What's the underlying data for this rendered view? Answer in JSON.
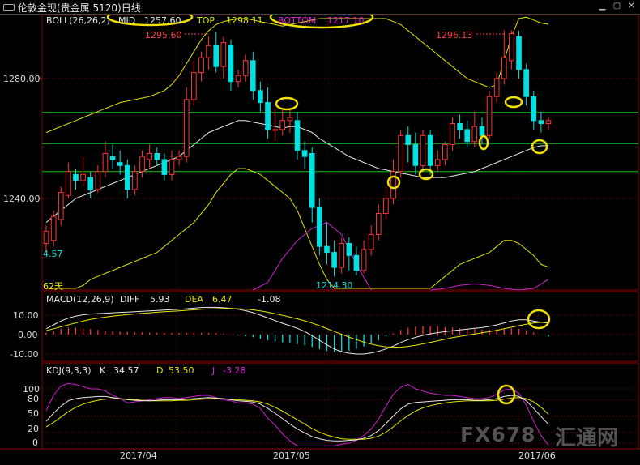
{
  "window": {
    "title": "伦敦金现(贵金属 5120)日线"
  },
  "boll": {
    "name": "BOLL(26,26,2)",
    "mid_label": "MID",
    "mid_value": "1257.60",
    "top_label": "TOP",
    "top_value": "1298.11",
    "bottom_label": "BOTTOM",
    "bottom_value": "1217.10"
  },
  "macd": {
    "name": "MACD(12,26,9)",
    "diff_label": "DIFF",
    "diff_value": "5.93",
    "dea_label": "DEA",
    "dea_value": "6.47",
    "macd_value": "-1.08"
  },
  "kdj": {
    "name": "KDJ(9,3,3)",
    "k_label": "K",
    "k_value": "34.57",
    "d_label": "D",
    "d_value": "53.50",
    "j_label": "J",
    "j_value": "-3.28"
  },
  "annotations": {
    "high1": "1295.60",
    "high2": "1296.13",
    "low": "1214.30",
    "left_low": "4.57",
    "days": "62天"
  },
  "y_ticks_main": [
    "1280.00",
    "1240.00"
  ],
  "y_ticks_macd": [
    "10.00",
    "0.00",
    "-10.00"
  ],
  "y_ticks_kdj": [
    "100",
    "80",
    "50",
    "20",
    "0"
  ],
  "x_ticks": [
    "2017/04",
    "2017/05",
    "2017/06"
  ],
  "watermark": {
    "text": "FX678",
    "cn": "汇通网"
  },
  "colors": {
    "up": "#ff3333",
    "down": "#00e0e0",
    "mid": "#e8e8e8",
    "bands": "#e0e000",
    "ma": "#d020d0",
    "level": "#00cc00",
    "circle": "#f0e000"
  },
  "chart_data": {
    "type": "candlestick",
    "y_range": [
      1206,
      1303
    ],
    "level_lines": [
      1268.7,
      1258.3,
      1249.0
    ],
    "candles": [
      [
        1225,
        1229,
        1222,
        1231
      ],
      [
        1226,
        1234,
        1224,
        1236
      ],
      [
        1233,
        1242,
        1231,
        1244
      ],
      [
        1241,
        1249,
        1240,
        1252
      ],
      [
        1248,
        1246,
        1243,
        1250
      ],
      [
        1246,
        1248,
        1244,
        1254
      ],
      [
        1247,
        1243,
        1240,
        1249
      ],
      [
        1243,
        1249,
        1242,
        1251
      ],
      [
        1249,
        1255,
        1247,
        1259
      ],
      [
        1254,
        1253,
        1250,
        1258
      ],
      [
        1252,
        1251,
        1248,
        1256
      ],
      [
        1251,
        1243,
        1240,
        1253
      ],
      [
        1243,
        1249,
        1241,
        1251
      ],
      [
        1249,
        1254,
        1247,
        1256
      ],
      [
        1253,
        1255,
        1250,
        1258
      ],
      [
        1255,
        1253,
        1251,
        1257
      ],
      [
        1253,
        1248,
        1246,
        1255
      ],
      [
        1248,
        1253,
        1246,
        1256
      ],
      [
        1253,
        1254,
        1251,
        1256
      ],
      [
        1254,
        1273,
        1252,
        1277
      ],
      [
        1273,
        1282,
        1271,
        1286
      ],
      [
        1282,
        1287,
        1279,
        1289
      ],
      [
        1287,
        1291,
        1283,
        1294
      ],
      [
        1291,
        1284,
        1282,
        1295.6
      ],
      [
        1284,
        1292,
        1280,
        1294
      ],
      [
        1291,
        1279,
        1276,
        1293
      ],
      [
        1279,
        1281,
        1277,
        1283
      ],
      [
        1281,
        1286,
        1279,
        1288
      ],
      [
        1286,
        1276,
        1273,
        1289
      ],
      [
        1276,
        1272,
        1269,
        1279
      ],
      [
        1272,
        1263,
        1260,
        1277
      ],
      [
        1263,
        1263,
        1259,
        1270
      ],
      [
        1263,
        1266,
        1261,
        1270
      ],
      [
        1266,
        1267,
        1262,
        1270
      ],
      [
        1266,
        1256,
        1253,
        1269
      ],
      [
        1256,
        1254,
        1250,
        1259
      ],
      [
        1255,
        1237,
        1232,
        1257
      ],
      [
        1237,
        1224,
        1221,
        1240
      ],
      [
        1224,
        1222,
        1218,
        1232
      ],
      [
        1222,
        1217,
        1214,
        1226
      ],
      [
        1217,
        1225,
        1215,
        1227
      ],
      [
        1225,
        1221,
        1216,
        1227
      ],
      [
        1221,
        1216,
        1214.3,
        1224
      ],
      [
        1216,
        1223,
        1215,
        1226
      ],
      [
        1223,
        1228,
        1221,
        1231
      ],
      [
        1228,
        1235,
        1226,
        1238
      ],
      [
        1235,
        1240,
        1233,
        1244
      ],
      [
        1240,
        1249,
        1238,
        1253
      ],
      [
        1249,
        1261,
        1247,
        1263
      ],
      [
        1261,
        1258,
        1252,
        1264
      ],
      [
        1258,
        1251,
        1248,
        1262
      ],
      [
        1251,
        1261,
        1249,
        1263
      ],
      [
        1261,
        1251,
        1248,
        1263
      ],
      [
        1251,
        1253,
        1249,
        1256
      ],
      [
        1253,
        1258,
        1251,
        1259
      ],
      [
        1258,
        1265,
        1256,
        1267
      ],
      [
        1265,
        1263,
        1260,
        1268
      ],
      [
        1263,
        1259,
        1257,
        1266
      ],
      [
        1259,
        1264,
        1257,
        1269
      ],
      [
        1264,
        1261,
        1258,
        1267
      ],
      [
        1261,
        1274,
        1260,
        1276
      ],
      [
        1274,
        1280,
        1272,
        1282
      ],
      [
        1280,
        1287,
        1278,
        1296.13
      ],
      [
        1286,
        1295,
        1283,
        1296.13
      ],
      [
        1294,
        1283,
        1280,
        1296
      ],
      [
        1283,
        1274,
        1271,
        1285
      ],
      [
        1274,
        1266,
        1263,
        1276
      ],
      [
        1266,
        1265,
        1262,
        1269
      ],
      [
        1265,
        1266,
        1263,
        1267
      ]
    ],
    "boll_mid": [
      1232,
      1234,
      1236,
      1238,
      1240,
      1241,
      1242,
      1243,
      1244,
      1245,
      1246,
      1247,
      1248,
      1249,
      1250,
      1251,
      1252,
      1253,
      1254,
      1256,
      1258,
      1260,
      1262,
      1263,
      1264,
      1265,
      1266,
      1266,
      1265.5,
      1265,
      1264.5,
      1264,
      1263.5,
      1264,
      1264,
      1263,
      1262,
      1260,
      1258.5,
      1257,
      1255.5,
      1254,
      1253,
      1252,
      1251,
      1250,
      1249.5,
      1249,
      1248.5,
      1248,
      1247.5,
      1247,
      1247,
      1247,
      1247,
      1247.5,
      1248,
      1248.5,
      1249,
      1250,
      1251,
      1252,
      1253,
      1254,
      1255,
      1256,
      1257,
      1257.6,
      1257.6
    ],
    "boll_top": [
      1262,
      1263,
      1264,
      1265,
      1266,
      1267,
      1268,
      1269,
      1270,
      1271,
      1272,
      1272.5,
      1273,
      1273.5,
      1274,
      1275,
      1276,
      1278,
      1281,
      1285,
      1289,
      1293,
      1296,
      1298,
      1299,
      1299.5,
      1300,
      1300,
      1299.5,
      1299,
      1298.5,
      1298,
      1297.5,
      1298,
      1298.5,
      1299,
      1299.5,
      1300,
      1300,
      1300,
      1300,
      1300,
      1300,
      1300,
      1300,
      1300,
      1300,
      1299,
      1298,
      1296,
      1294,
      1292,
      1290,
      1288,
      1286,
      1284,
      1282,
      1280,
      1279,
      1278,
      1277,
      1278,
      1286,
      1294,
      1300,
      1300.5,
      1299.5,
      1298.5,
      1298.1
    ],
    "boll_bottom": [
      1202,
      1203,
      1205,
      1207,
      1209,
      1211,
      1213,
      1214,
      1215,
      1216,
      1217,
      1218,
      1219,
      1220,
      1221,
      1222,
      1224,
      1226,
      1228,
      1230,
      1232,
      1235,
      1238,
      1242,
      1245,
      1248,
      1250,
      1250,
      1249,
      1248,
      1246,
      1244,
      1242,
      1240,
      1236,
      1230,
      1224,
      1218,
      1213,
      1208,
      1204,
      1200,
      1198,
      1198,
      1198,
      1199,
      1200,
      1201,
      1202,
      1204,
      1206,
      1208,
      1210,
      1212,
      1214,
      1216,
      1218,
      1219,
      1220,
      1221,
      1222,
      1224,
      1226,
      1226,
      1225,
      1223,
      1221,
      1218,
      1217.1
    ],
    "ma62_points": [
      [
        28,
        1202
      ],
      [
        30,
        1212
      ],
      [
        32,
        1220
      ],
      [
        34,
        1226
      ],
      [
        36,
        1230
      ],
      [
        38,
        1232
      ],
      [
        40,
        1228
      ],
      [
        42,
        1218
      ],
      [
        44,
        1208
      ]
    ],
    "ma62_right": [
      [
        52,
        1208
      ],
      [
        54,
        1210
      ],
      [
        56,
        1211
      ],
      [
        58,
        1211.5
      ],
      [
        60,
        1211
      ],
      [
        62,
        1210
      ],
      [
        64,
        1208
      ],
      [
        66,
        1210
      ],
      [
        68,
        1213
      ]
    ],
    "macd_range": [
      -13,
      15
    ],
    "macd_diff": [
      3,
      5,
      7,
      8.5,
      9.5,
      10.2,
      10.6,
      10.8,
      11,
      11.2,
      11.4,
      11.6,
      11.8,
      12,
      12.2,
      12.4,
      12.6,
      12.8,
      13,
      13.3,
      13.6,
      13.9,
      14,
      14,
      13.8,
      13.5,
      13,
      12.3,
      11.3,
      10,
      8.6,
      7.2,
      5.8,
      4.6,
      3.2,
      1.6,
      -0.5,
      -3,
      -5.3,
      -7.4,
      -8.8,
      -9.6,
      -10,
      -10,
      -9.5,
      -8.6,
      -7.4,
      -5.9,
      -4.1,
      -2.6,
      -1.4,
      -0.4,
      0.4,
      1,
      1.5,
      2,
      2.4,
      2.8,
      3.2,
      3.6,
      4.2,
      5,
      6,
      7,
      7.6,
      7.6,
      7,
      6.3,
      5.93
    ],
    "macd_dea": [
      2,
      3,
      4,
      5,
      6,
      7,
      7.8,
      8.4,
      9,
      9.5,
      9.9,
      10.3,
      10.6,
      10.9,
      11.2,
      11.5,
      11.8,
      12,
      12.2,
      12.5,
      12.7,
      13,
      13.2,
      13.3,
      13.4,
      13.4,
      13.3,
      13.1,
      12.7,
      12.2,
      11.5,
      10.7,
      9.9,
      9,
      8.1,
      7.1,
      5.9,
      4.6,
      3.1,
      1.6,
      0.2,
      -1.3,
      -2.6,
      -3.9,
      -4.9,
      -5.7,
      -6.3,
      -6.5,
      -6.5,
      -6.1,
      -5.5,
      -4.8,
      -4,
      -3.2,
      -2.4,
      -1.6,
      -0.9,
      -0.3,
      0.3,
      0.9,
      1.5,
      2.2,
      3,
      3.8,
      4.6,
      5.3,
      5.9,
      6.3,
      6.47
    ],
    "macd_hist": [
      1,
      2,
      3,
      3.5,
      3.5,
      3.2,
      2.8,
      2.4,
      2,
      1.7,
      1.5,
      1.3,
      1.2,
      1.1,
      1,
      0.9,
      0.8,
      0.8,
      0.8,
      0.8,
      0.9,
      0.9,
      0.8,
      0.7,
      0.4,
      0.1,
      -0.3,
      -0.8,
      -1.4,
      -2.2,
      -2.9,
      -3.5,
      -4.1,
      -4.4,
      -4.9,
      -5.5,
      -6.4,
      -7.6,
      -8.4,
      -9,
      -9,
      -8.3,
      -7.4,
      -6.1,
      -4.6,
      -2.9,
      -1.1,
      0.6,
      2.4,
      3.5,
      4.1,
      4.4,
      4.4,
      4.2,
      3.9,
      3.6,
      3.3,
      3.1,
      2.9,
      2.7,
      2.7,
      2.8,
      3,
      3.2,
      3,
      2.3,
      1.1,
      0,
      -1.08
    ],
    "kdj_range": [
      -5,
      115
    ],
    "kdj_k": [
      40,
      55,
      68,
      78,
      82,
      84,
      85,
      86,
      86,
      84,
      82,
      80,
      79,
      78,
      78,
      79,
      80,
      80,
      80,
      81,
      82,
      83,
      84,
      83,
      82,
      80,
      78,
      77,
      76,
      72,
      64,
      55,
      45,
      35,
      26,
      19,
      12,
      8,
      5,
      4,
      4,
      5,
      6,
      9,
      14,
      23,
      36,
      50,
      63,
      72,
      75,
      76,
      77,
      78,
      79,
      80,
      80,
      80,
      79,
      79,
      80,
      82,
      86,
      88,
      86,
      78,
      64,
      49,
      34.57
    ],
    "kdj_d": [
      30,
      38,
      48,
      58,
      66,
      72,
      76,
      79,
      81,
      82,
      82,
      81,
      80,
      79,
      78,
      78,
      78,
      78,
      79,
      79,
      80,
      81,
      82,
      82,
      82,
      81,
      80,
      79,
      78,
      76,
      72,
      66,
      59,
      51,
      43,
      35,
      27,
      20,
      15,
      11,
      8,
      7,
      7,
      7,
      9,
      13,
      20,
      30,
      41,
      51,
      59,
      65,
      69,
      72,
      74,
      76,
      77,
      78,
      78,
      78,
      78,
      79,
      81,
      83,
      84,
      82,
      76,
      66,
      53.5
    ],
    "kdj_j": [
      60,
      88,
      105,
      110,
      108,
      104,
      100,
      100,
      96,
      88,
      82,
      74,
      76,
      78,
      80,
      82,
      84,
      84,
      82,
      84,
      86,
      88,
      88,
      84,
      80,
      78,
      74,
      74,
      72,
      64,
      46,
      33,
      17,
      4,
      -5,
      -5,
      -5,
      -5,
      -5,
      -5,
      -2,
      0,
      5,
      14,
      26,
      44,
      68,
      90,
      103,
      108,
      100,
      96,
      92,
      90,
      88,
      88,
      86,
      84,
      82,
      82,
      84,
      90,
      98,
      100,
      92,
      70,
      40,
      14,
      -3.28
    ]
  }
}
